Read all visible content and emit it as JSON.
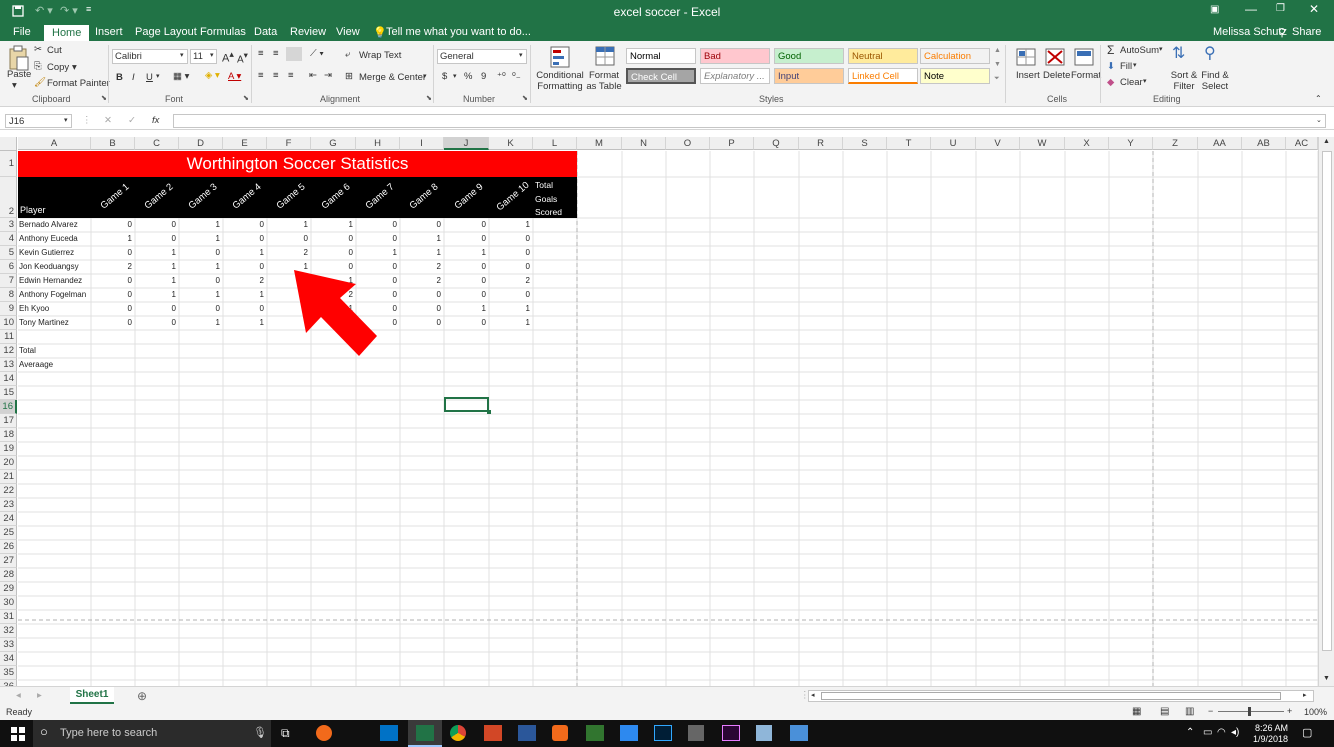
{
  "window": {
    "title": "excel soccer - Excel",
    "user": "Melissa Schutz",
    "share": "Share"
  },
  "tabs": [
    {
      "label": "File"
    },
    {
      "label": "Home"
    },
    {
      "label": "Insert"
    },
    {
      "label": "Page Layout"
    },
    {
      "label": "Formulas"
    },
    {
      "label": "Data"
    },
    {
      "label": "Review"
    },
    {
      "label": "View"
    }
  ],
  "tell_me": "Tell me what you want to do...",
  "ribbon": {
    "clipboard": {
      "paste": "Paste",
      "cut": "Cut",
      "copy": "Copy",
      "format_painter": "Format Painter",
      "label": "Clipboard"
    },
    "font": {
      "name": "Calibri",
      "size": "11",
      "label": "Font",
      "bold": "B",
      "italic": "I",
      "underline": "U"
    },
    "alignment": {
      "wrap": "Wrap Text",
      "merge": "Merge & Center",
      "label": "Alignment"
    },
    "number": {
      "format": "General",
      "currency": "$",
      "percent": "%",
      "comma": "9",
      "label": "Number"
    },
    "styles": {
      "conditional": "Conditional Formatting",
      "format_table": "Format as Table",
      "label": "Styles",
      "cells": [
        {
          "label": "Normal",
          "bg": "#ffffff",
          "fg": "#000000"
        },
        {
          "label": "Bad",
          "bg": "#ffc7ce",
          "fg": "#9c0006"
        },
        {
          "label": "Good",
          "bg": "#c6efce",
          "fg": "#006100"
        },
        {
          "label": "Neutral",
          "bg": "#ffeb9c",
          "fg": "#9c5700"
        },
        {
          "label": "Calculation",
          "bg": "#f2f2f2",
          "fg": "#fa7d00"
        },
        {
          "label": "Check Cell",
          "bg": "#a5a5a5",
          "fg": "#ffffff"
        },
        {
          "label": "Explanatory ...",
          "bg": "#ffffff",
          "fg": "#7f7f7f"
        },
        {
          "label": "Input",
          "bg": "#ffcc99",
          "fg": "#3f3f76"
        },
        {
          "label": "Linked Cell",
          "bg": "#ffffff",
          "fg": "#fa7d00"
        },
        {
          "label": "Note",
          "bg": "#ffffcc",
          "fg": "#000000"
        }
      ]
    },
    "cells_group": {
      "insert": "Insert",
      "delete": "Delete",
      "format": "Format",
      "label": "Cells"
    },
    "editing": {
      "autosum": "AutoSum",
      "fill": "Fill",
      "clear": "Clear",
      "sort": "Sort & Filter",
      "find": "Find & Select",
      "label": "Editing"
    }
  },
  "formula_bar": {
    "name_box": "J16",
    "fx": "fx",
    "cancel": "✕",
    "enter": "✓",
    "value": ""
  },
  "columns": [
    "A",
    "B",
    "C",
    "D",
    "E",
    "F",
    "G",
    "H",
    "I",
    "J",
    "K",
    "L",
    "M",
    "N",
    "O",
    "P",
    "Q",
    "R",
    "S",
    "T",
    "U",
    "V",
    "W",
    "X",
    "Y",
    "Z",
    "AA",
    "AB",
    "AC"
  ],
  "rows": [
    "1",
    "2",
    "3",
    "4",
    "5",
    "6",
    "7",
    "8",
    "9",
    "10",
    "11",
    "12",
    "13",
    "14",
    "15",
    "16",
    "17",
    "18",
    "19",
    "20",
    "21",
    "22",
    "23",
    "24",
    "25",
    "26",
    "27",
    "28",
    "29",
    "30",
    "31",
    "32",
    "33",
    "34",
    "35",
    "36"
  ],
  "sheet": {
    "title": "Worthington Soccer Statistics",
    "title_bg": "#ff0000",
    "header_bg": "#000000",
    "player_header": "Player",
    "game_headers": [
      "Game 1",
      "Game 2",
      "Game 3",
      "Game 4",
      "Game 5",
      "Game 6",
      "Game 7",
      "Game 8",
      "Game 9",
      "Game 10"
    ],
    "total_header": [
      "Total",
      "Goals",
      "Scored"
    ],
    "players": [
      {
        "name": "Bernado Alvarez",
        "goals": [
          "0",
          "0",
          "1",
          "0",
          "1",
          "1",
          "0",
          "0",
          "0",
          "1"
        ]
      },
      {
        "name": "Anthony Euceda",
        "goals": [
          "1",
          "0",
          "1",
          "0",
          "0",
          "0",
          "0",
          "1",
          "0",
          "0"
        ]
      },
      {
        "name": "Kevin Gutierrez",
        "goals": [
          "0",
          "1",
          "0",
          "1",
          "2",
          "0",
          "1",
          "1",
          "1",
          "0"
        ]
      },
      {
        "name": "Jon Keoduangsy",
        "goals": [
          "2",
          "1",
          "1",
          "0",
          "1",
          "0",
          "0",
          "2",
          "0",
          "0"
        ]
      },
      {
        "name": "Edwin Hernandez",
        "goals": [
          "0",
          "1",
          "0",
          "2",
          "",
          "1",
          "0",
          "2",
          "0",
          "2"
        ]
      },
      {
        "name": "Anthony Fogelman",
        "goals": [
          "0",
          "1",
          "1",
          "1",
          "",
          "2",
          "0",
          "0",
          "0",
          "0"
        ]
      },
      {
        "name": "Eh Kyoo",
        "goals": [
          "0",
          "0",
          "0",
          "0",
          "",
          "1",
          "0",
          "0",
          "1",
          "1"
        ]
      },
      {
        "name": "Tony Martinez",
        "goals": [
          "0",
          "0",
          "1",
          "1",
          "",
          "",
          "0",
          "0",
          "0",
          "1"
        ]
      }
    ],
    "total_label": "Total",
    "average_label": "Averaage"
  },
  "sheet_tabs": [
    {
      "label": "Sheet1"
    }
  ],
  "status": {
    "ready": "Ready",
    "zoom": "100%"
  },
  "taskbar": {
    "search": "Type here to search",
    "time": "8:26 AM",
    "date": "1/9/2018"
  },
  "arrow_color": "#ff0000",
  "accent": "#217346"
}
